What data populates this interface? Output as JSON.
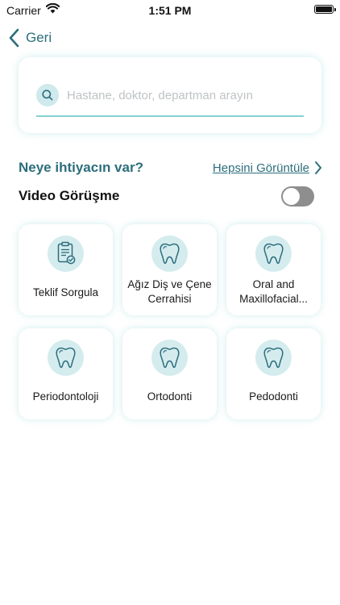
{
  "status_bar": {
    "carrier": "Carrier",
    "time": "1:51 PM"
  },
  "nav": {
    "back_label": "Geri"
  },
  "search": {
    "placeholder": "Hastane, doktor, departman arayın",
    "value": ""
  },
  "section": {
    "title": "Neye ihtiyacın var?",
    "see_all": "Hepsini Görüntüle"
  },
  "video_call": {
    "label": "Video Görüşme",
    "enabled": false
  },
  "categories": [
    {
      "label": "Teklif Sorgula",
      "icon": "clipboard-check-icon"
    },
    {
      "label": "Ağız Diş ve Çene Cerrahisi",
      "icon": "tooth-icon"
    },
    {
      "label": "Oral and Maxillofacial...",
      "icon": "tooth-icon"
    },
    {
      "label": "Periodontoloji",
      "icon": "tooth-icon"
    },
    {
      "label": "Ortodonti",
      "icon": "tooth-icon"
    },
    {
      "label": "Pedodonti",
      "icon": "tooth-icon"
    }
  ],
  "colors": {
    "accent": "#2c6e7c",
    "icon_bg": "#d5ecee",
    "search_line": "#86cfd2",
    "toggle_off": "#8e8e8e"
  }
}
